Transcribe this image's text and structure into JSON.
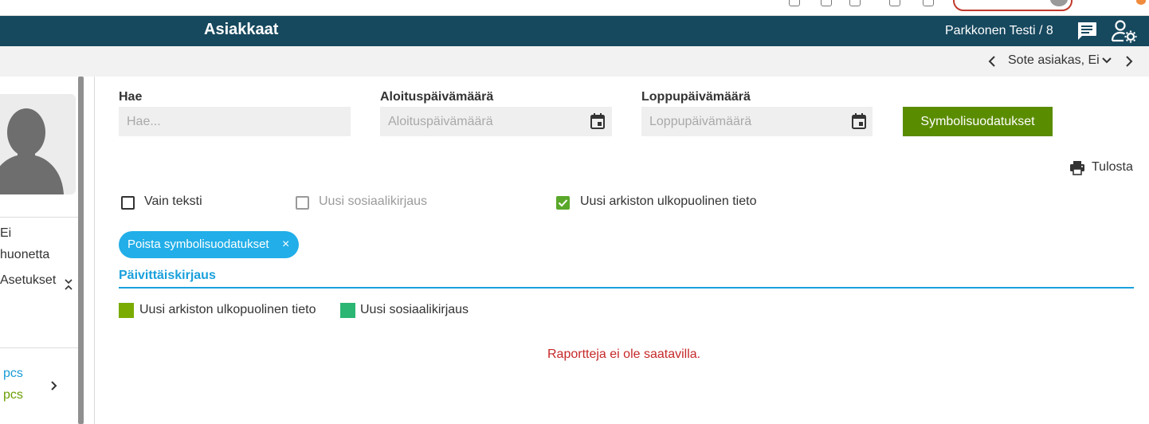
{
  "app": {
    "title": "Asiakkaat",
    "user": "Parkkonen Testi / 8"
  },
  "subbar": {
    "breadcrumb": "Sote asiakas, Ei"
  },
  "left_panel": {
    "line1": "Ei",
    "line2": "huonetta",
    "settings_label": "Asetukset",
    "count1": "pcs",
    "count2": "pcs"
  },
  "filters": {
    "search": {
      "label": "Hae",
      "placeholder": "Hae..."
    },
    "start_date": {
      "label": "Aloituspäivämäärä",
      "placeholder": "Aloituspäivämäärä"
    },
    "end_date": {
      "label": "Loppupäivämäärä",
      "placeholder": "Loppupäivämäärä"
    },
    "symbol_filter_button": "Symbolisuodatukset"
  },
  "print_label": "Tulosta",
  "checkboxes": [
    {
      "label": "Vain teksti",
      "checked": false,
      "disabled": false
    },
    {
      "label": "Uusi sosiaalikirjaus",
      "checked": false,
      "disabled": true
    },
    {
      "label": "Uusi arkiston ulkopuolinen tieto",
      "checked": true,
      "disabled": false
    }
  ],
  "chip": {
    "label": "Poista symbolisuodatukset",
    "close": "×"
  },
  "tab": {
    "label": "Päivittäiskirjaus"
  },
  "legend": [
    {
      "label": "Uusi arkiston ulkopuolinen tieto",
      "color": "#7aab00"
    },
    {
      "label": "Uusi sosiaalikirjaus",
      "color": "#2bb673"
    }
  ],
  "empty_message": "Raportteja ei ole saatavilla.",
  "colors": {
    "navbar": "#16485e",
    "accent": "#1aa0dc",
    "button": "#5a8c00",
    "error": "#c62828"
  }
}
